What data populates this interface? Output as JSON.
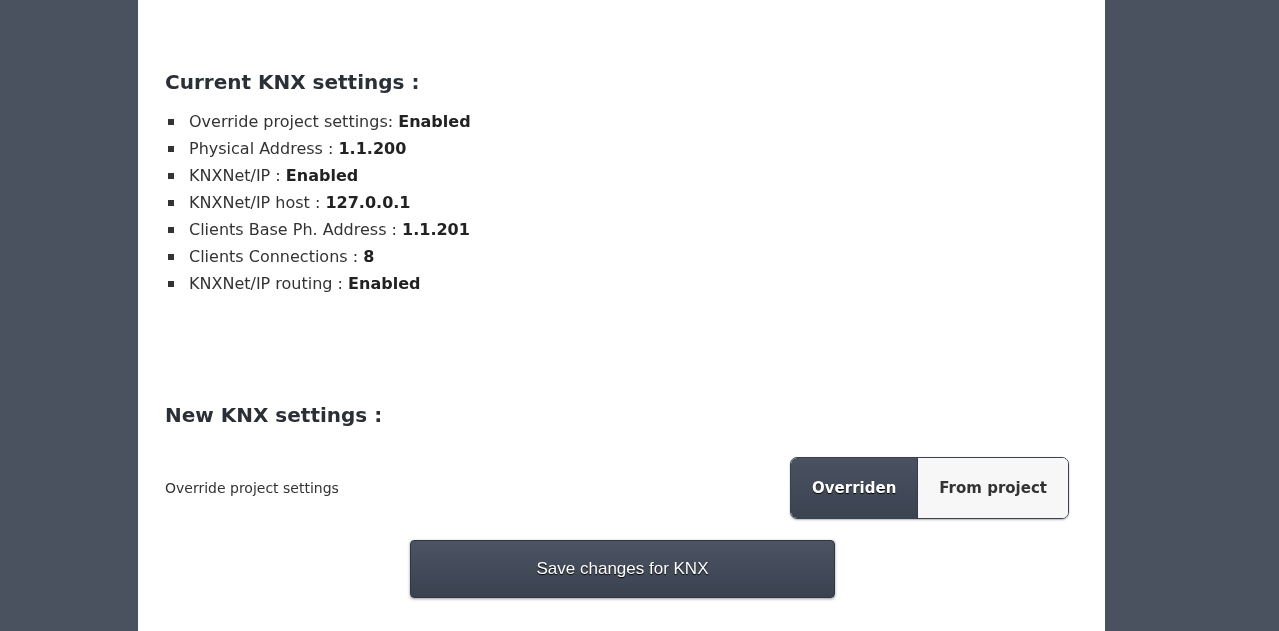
{
  "current_settings": {
    "heading": "Current KNX settings :",
    "items": [
      "Override project settings: **Enabled**",
      "Physical Address : **1.1.200**",
      "KNXNet/IP : **Enabled**",
      "KNXNet/IP host : **127.0.0.1**",
      "Clients Base Ph. Address : **1.1.201**",
      "Clients Connections : **8**",
      "KNXNet/IP routing : **Enabled**"
    ]
  },
  "new_settings": {
    "heading": "New KNX settings :",
    "override": {
      "label": "Override project settings",
      "options": [
        {
          "label": "Overriden",
          "selected": true
        },
        {
          "label": "From project",
          "selected": false
        }
      ]
    }
  },
  "save_button": "Save changes for KNX"
}
